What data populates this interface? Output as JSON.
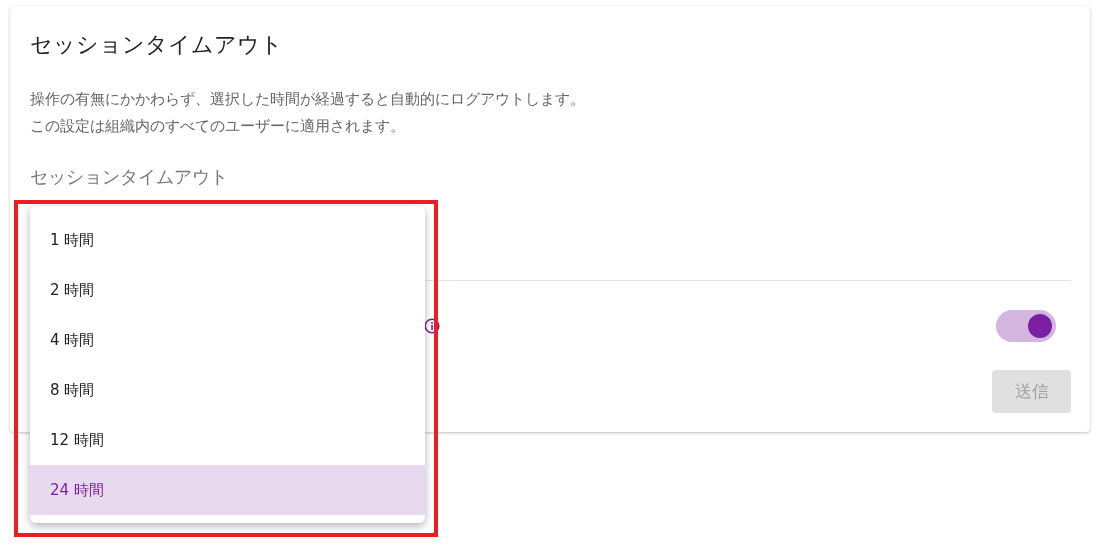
{
  "card": {
    "title": "セッションタイムアウト",
    "description": [
      "操作の有無にかかわらず、選択した時間が経過すると自動的にログアウトします。",
      "この設定は組織内のすべてのユーザーに適用されます。"
    ],
    "field": {
      "label": "セッションタイムアウト"
    },
    "toggle": {
      "on": true
    },
    "submit_button": {
      "label": "送信",
      "disabled": true
    }
  },
  "dropdown_menu": {
    "options": [
      {
        "label": "1 時間",
        "selected": false
      },
      {
        "label": "2 時間",
        "selected": false
      },
      {
        "label": "4 時間",
        "selected": false
      },
      {
        "label": "8 時間",
        "selected": false
      },
      {
        "label": "12 時間",
        "selected": false
      },
      {
        "label": "24 時間",
        "selected": true
      }
    ]
  }
}
